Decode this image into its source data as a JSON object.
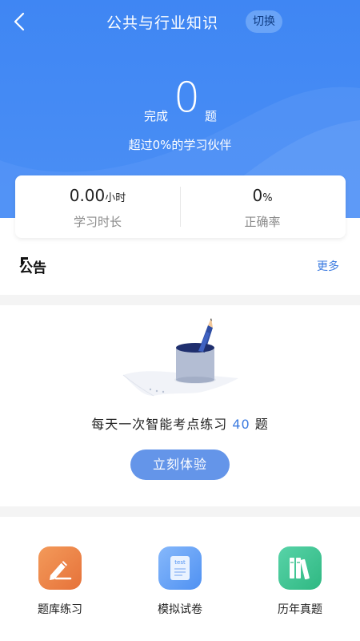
{
  "header": {
    "title": "公共与行业知识",
    "switch_label": "切换",
    "done_label": "完成",
    "done_count": "0",
    "done_unit": "题",
    "beyond_text": "超过0%的学习伙伴",
    "bg_color": "#4a8ef5"
  },
  "stats": {
    "study_time_value": "0.00",
    "study_time_unit": "小时",
    "study_time_label": "学习时长",
    "accuracy_value": "0",
    "accuracy_unit": "%",
    "accuracy_label": "正确率"
  },
  "notice": {
    "title": "公告",
    "more_label": "更多"
  },
  "daily": {
    "text_prefix": "每天一次智能考点练习",
    "count": "40",
    "text_suffix": "题",
    "button_label": "立刻体验"
  },
  "features": [
    {
      "label": "题库练习",
      "icon": "pencil-note-icon",
      "color": "#ee7d45"
    },
    {
      "label": "模拟试卷",
      "icon": "test-paper-icon",
      "icon_text": "test",
      "color": "#5f9cf4"
    },
    {
      "label": "历年真题",
      "icon": "books-icon",
      "color": "#3cc490"
    }
  ]
}
